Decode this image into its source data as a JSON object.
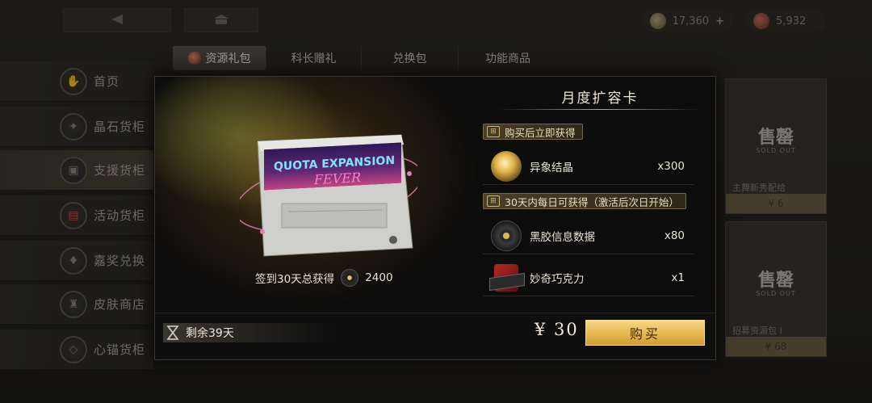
{
  "header": {
    "currencies": [
      {
        "name": "diamond-currency",
        "value": "17,360",
        "has_plus": true
      },
      {
        "name": "crystal-currency",
        "value": "5,932",
        "has_plus": false
      }
    ],
    "plus_symbol": "+"
  },
  "tabs": [
    {
      "label": "资源礼包",
      "active": true
    },
    {
      "label": "科长赠礼",
      "active": false
    },
    {
      "label": "兑换包",
      "active": false
    },
    {
      "label": "功能商品",
      "active": false
    }
  ],
  "sidebar": {
    "items": [
      {
        "label": "首页",
        "icon": "home-shield-icon",
        "selected": false
      },
      {
        "label": "晶石货柜",
        "icon": "crystal-icon",
        "selected": false
      },
      {
        "label": "支援货柜",
        "icon": "supply-box-icon",
        "selected": true
      },
      {
        "label": "活动货柜",
        "icon": "event-ticket-icon",
        "selected": false
      },
      {
        "label": "嘉奖兑换",
        "icon": "award-icon",
        "selected": false
      },
      {
        "label": "皮肤商店",
        "icon": "outfit-icon",
        "selected": false
      },
      {
        "label": "心锚货柜",
        "icon": "heart-anchor-icon",
        "selected": false
      }
    ]
  },
  "bg_cards": [
    {
      "soldout": "售罄",
      "soldout_en": "SOLD OUT",
      "name": "主舞新秀配给",
      "price": "¥ 6"
    },
    {
      "soldout": "售罄",
      "soldout_en": "SOLD OUT",
      "name": "招募资源包 I",
      "price": "¥ 68"
    }
  ],
  "modal": {
    "title": "月度扩容卡",
    "cartridge": {
      "line1": "QUOTA EXPANSION",
      "line2": "FEVER"
    },
    "checkin_text": "签到30天总获得",
    "checkin_amount": "2400",
    "sections": [
      {
        "tag": "购买后立即获得",
        "rewards": [
          {
            "name": "异象结晶",
            "qty": "x300",
            "icon": "crystal-orb-icon"
          }
        ]
      },
      {
        "tag": "30天内每日可获得（激活后次日开始）",
        "rewards": [
          {
            "name": "黑胶信息数据",
            "qty": "x80",
            "icon": "vinyl-record-icon"
          },
          {
            "name": "妙奇巧克力",
            "qty": "x1",
            "icon": "chocolate-icon"
          }
        ]
      }
    ],
    "remaining": "剩余39天",
    "price": "¥ 30",
    "buy_label": "购买"
  },
  "colors": {
    "accent_gold": "#e6b850",
    "background": "#24221f",
    "modal_bg": "#0c0c0c",
    "text_light": "#e8e2d2"
  }
}
